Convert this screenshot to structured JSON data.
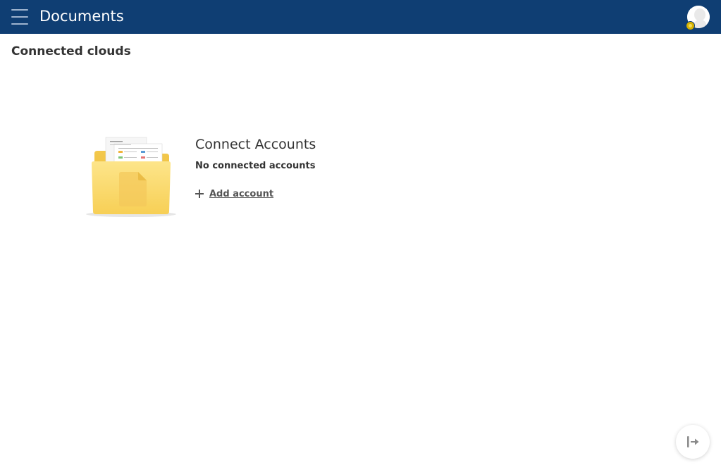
{
  "header": {
    "title": "Documents",
    "menu_icon": "hamburger-icon",
    "background": "#0f3e73",
    "avatar_icon": "user-avatar-icon",
    "badge_color": "#d6b200"
  },
  "main": {
    "section_title": "Connected clouds",
    "empty_state": {
      "illustration": "folder-icon",
      "title": "Connect Accounts",
      "description": "No connected accounts",
      "add_account_label": "Add account",
      "add_icon": "plus-icon"
    }
  },
  "floating_button": {
    "icon": "arrow-to-right-icon"
  }
}
